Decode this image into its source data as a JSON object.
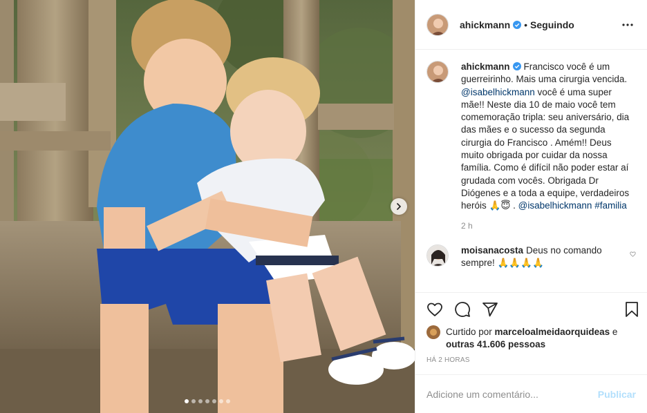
{
  "media": {
    "carousel_dots": 7,
    "active_dot": 0,
    "next_button_icon": "chevron-right-icon"
  },
  "header": {
    "username": "ahickmann",
    "verified_icon": "verified-badge-icon",
    "separator": "•",
    "follow_status": "Seguindo",
    "more_icon": "more-horizontal-icon"
  },
  "caption": {
    "username": "ahickmann",
    "text_1": "Francisco você é um guerreirinho. Mais uma cirurgia vencida. ",
    "mention_1": "@isabelhickmann",
    "text_2": " você é uma super mãe!! Neste dia 10 de maio você tem comemoração tripla: seu aniversário, dia das mães e o sucesso da segunda cirurgia do Francisco . Amém!! Deus muito obrigada por cuidar da nossa família. Como é difícil não poder estar aí grudada com vocês. Obrigada Dr Diógenes e a toda a equipe, verdadeiros heróis 🙏😇 .",
    "mention_2": "@isabelhickmann",
    "hashtag": "#familia",
    "time": "2 h"
  },
  "comment": {
    "username": "moisanacosta",
    "text": "Deus no comando sempre! 🙏🙏🙏🙏",
    "like_icon": "heart-outline-icon"
  },
  "actions": {
    "like_icon": "heart-icon",
    "comment_icon": "comment-icon",
    "share_icon": "share-icon",
    "save_icon": "bookmark-icon"
  },
  "likes": {
    "prefix": "Curtido por ",
    "user": "marceloalmeidaorquideas",
    "middle": " e ",
    "others": "outras 41.606 pessoas"
  },
  "timestamp": "HÁ 2 HORAS",
  "add_comment": {
    "placeholder": "Adicione um comentário...",
    "publish_label": "Publicar"
  },
  "colors": {
    "link": "#00376b",
    "verified": "#3897f0",
    "publish_disabled": "#b2dffc",
    "secondary_text": "#8e8e8e"
  }
}
